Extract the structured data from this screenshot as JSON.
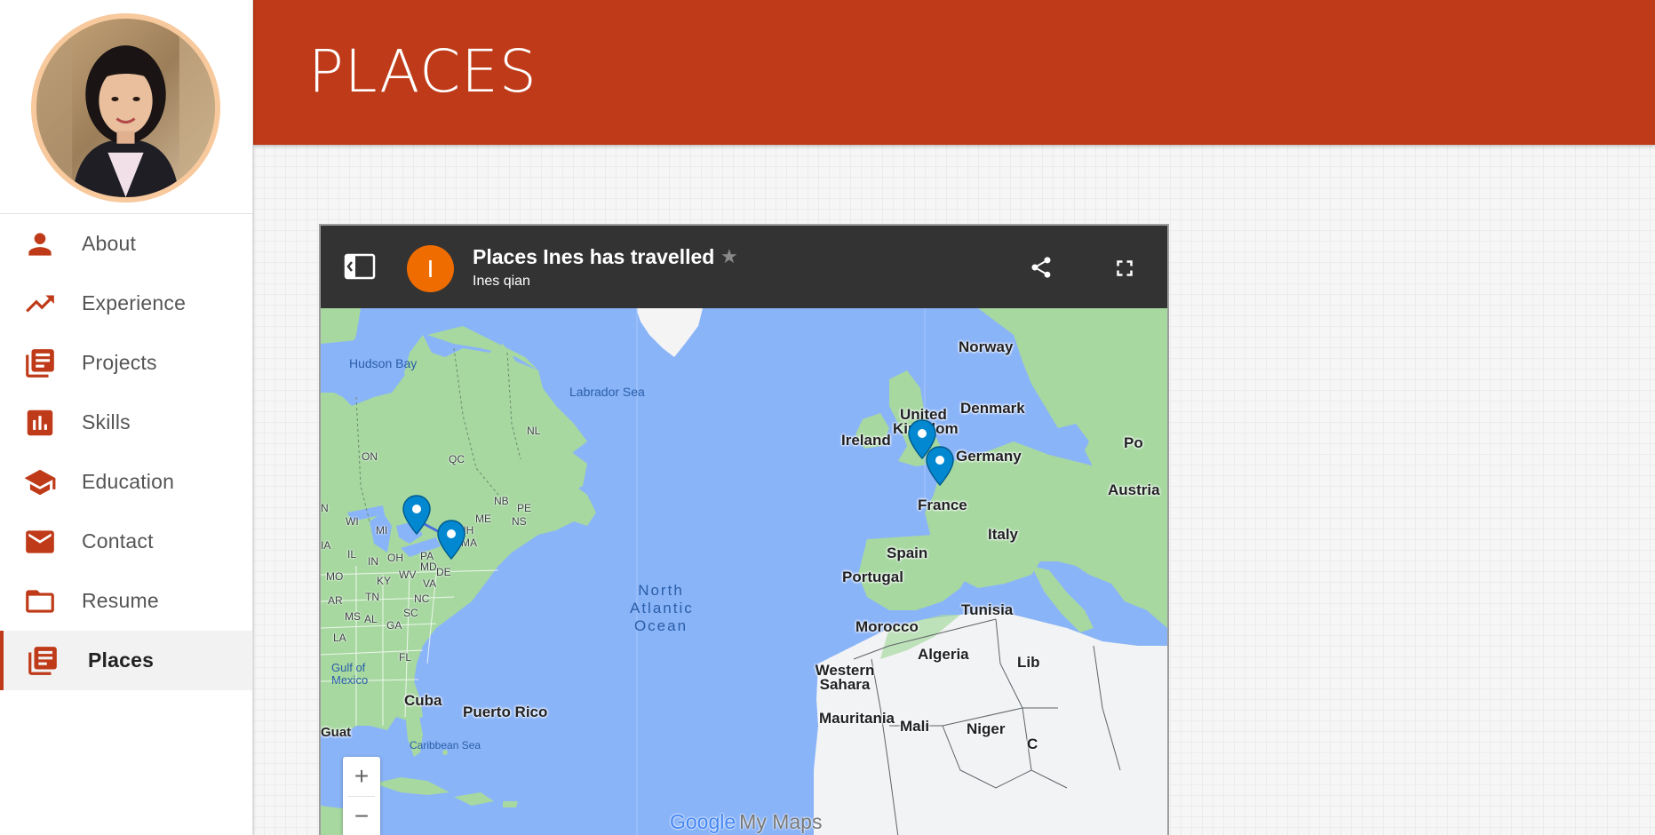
{
  "header": {
    "title": "PLACES"
  },
  "sidebar": {
    "items": [
      {
        "label": "About",
        "icon": "person-icon"
      },
      {
        "label": "Experience",
        "icon": "trending-up-icon"
      },
      {
        "label": "Projects",
        "icon": "library-books-icon"
      },
      {
        "label": "Skills",
        "icon": "bar-chart-icon"
      },
      {
        "label": "Education",
        "icon": "school-icon"
      },
      {
        "label": "Contact",
        "icon": "email-icon"
      },
      {
        "label": "Resume",
        "icon": "folder-icon"
      },
      {
        "label": "Places",
        "icon": "library-books-icon",
        "active": true
      }
    ]
  },
  "map": {
    "title": "Places Ines has travelled",
    "owner": "Ines qian",
    "owner_initial": "I",
    "branding": {
      "google": "Google",
      "product": "My Maps"
    },
    "zoom_in": "+",
    "zoom_out": "−",
    "labels": {
      "hudson_bay": "Hudson Bay",
      "labrador_sea": "Labrador Sea",
      "norway": "Norway",
      "denmark": "Denmark",
      "united": "United",
      "kingdom": "Kingdom",
      "ireland": "Ireland",
      "germany": "Germany",
      "austria": "Austria",
      "po": "Po",
      "france": "France",
      "italy": "Italy",
      "spain": "Spain",
      "portugal": "Portugal",
      "tunisia": "Tunisia",
      "morocco": "Morocco",
      "algeria": "Algeria",
      "lib": "Lib",
      "western_sahara": "Western Sahara",
      "mauritania": "Mauritania",
      "mali": "Mali",
      "niger": "Niger",
      "ocean_1": "North",
      "ocean_2": "Atlantic",
      "ocean_3": "Ocean",
      "cuba": "Cuba",
      "puerto_rico": "Puerto Rico",
      "caribbean_sea": "Caribbean Sea",
      "gulf": "Gulf of Mexico",
      "on": "ON",
      "qc": "QC",
      "nl": "NL",
      "nb": "NB",
      "pe": "PE",
      "ns": "NS",
      "me": "ME",
      "nh": "NH",
      "ma": "MA",
      "n": "N",
      "wi": "WI",
      "mi": "MI",
      "ia": "IA",
      "il": "IL",
      "in": "IN",
      "oh": "OH",
      "pa": "PA",
      "md": "MD",
      "de": "DE",
      "wv": "WV",
      "va": "VA",
      "mo": "MO",
      "ky": "KY",
      "ar": "AR",
      "tn": "TN",
      "nc": "NC",
      "ms": "MS",
      "al": "AL",
      "ga": "GA",
      "sc": "SC",
      "la": "LA",
      "fl": "FL",
      "guat": "Guat",
      "c": "C"
    }
  }
}
